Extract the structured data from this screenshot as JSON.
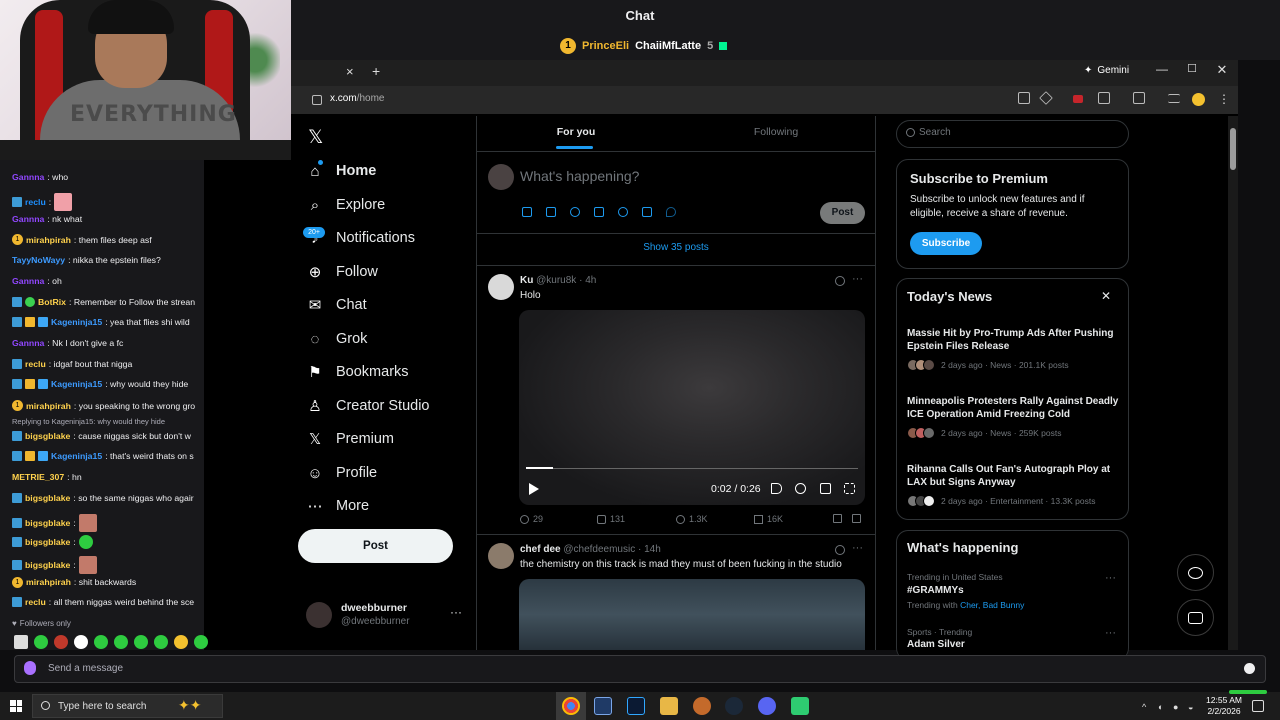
{
  "twitch": {
    "chat_title": "Chat",
    "leaderboard": {
      "rank": "1",
      "first_name": "PrinceEli",
      "second_name": "ChaiiMfLatte",
      "second_count": "5"
    },
    "messages": [
      {
        "user": "Gannna",
        "color": "#9147ff",
        "text": ": who",
        "badges": [],
        "emote": null
      },
      {
        "user": "reclu",
        "color": "#1e90ff",
        "text": ":",
        "badges": [
          "sub"
        ],
        "emote": "pink"
      },
      {
        "user": "Gannna",
        "color": "#9147ff",
        "text": ": nk what",
        "badges": [],
        "emote": null
      },
      {
        "user": "mirahpirah",
        "color": "#ffd24d",
        "text": ": them files deep asf",
        "badges": [
          "gold"
        ],
        "emote": null
      },
      {
        "user": "TayyNoWayy",
        "color": "#3d9bff",
        "text": ": nikka the epstein files?",
        "badges": [],
        "emote": null
      },
      {
        "user": "Gannna",
        "color": "#9147ff",
        "text": ": oh",
        "badges": [],
        "emote": null
      },
      {
        "user": "BotRix",
        "color": "#ffd24d",
        "text": ": Remember to Follow the strean",
        "badges": [
          "sub",
          "bot"
        ],
        "emote": null
      },
      {
        "user": "Kageninja15",
        "color": "#3d9bff",
        "text": ": yea that flies shi wild",
        "badges": [
          "sub",
          "crown",
          "gift"
        ],
        "emote": null
      },
      {
        "user": "Gannna",
        "color": "#9147ff",
        "text": ": Nk I don't give a fc",
        "badges": [],
        "emote": null
      },
      {
        "user": "reclu",
        "color": "#ffd24d",
        "text": ": idgaf bout that nigga",
        "badges": [
          "sub"
        ],
        "emote": null
      },
      {
        "user": "Kageninja15",
        "color": "#3d9bff",
        "text": ": why would they hide",
        "badges": [
          "sub",
          "crown",
          "gift"
        ],
        "emote": null
      },
      {
        "user": "mirahpirah",
        "color": "#ffd24d",
        "text": ": you speaking to the wrong gro",
        "badges": [
          "gold"
        ],
        "emote": null
      },
      {
        "user": "bigsgblake",
        "color": "#ffd24d",
        "text": ": cause niggas sick but don't w",
        "badges": [
          "sub"
        ],
        "emote": null,
        "reply": "Replying to Kageninja15: why would they hide"
      },
      {
        "user": "Kageninja15",
        "color": "#3d9bff",
        "text": ": that's weird thats on s",
        "badges": [
          "sub",
          "crown",
          "gift"
        ],
        "emote": null
      },
      {
        "user": "METRIE_307",
        "color": "#ffd24d",
        "text": ": hn",
        "badges": [],
        "emote": null
      },
      {
        "user": "bigsgblake",
        "color": "#ffd24d",
        "text": ": so the same niggas who agair",
        "badges": [
          "sub"
        ],
        "emote": null
      },
      {
        "user": "bigsgblake",
        "color": "#ffd24d",
        "text": ":",
        "badges": [
          "sub"
        ],
        "emote": "face"
      },
      {
        "user": "bigsgblake",
        "color": "#ffd24d",
        "text": ":",
        "badges": [
          "sub"
        ],
        "emote": "green"
      },
      {
        "user": "bigsgblake",
        "color": "#ffd24d",
        "text": ":",
        "badges": [
          "sub"
        ],
        "emote": "face"
      },
      {
        "user": "mirahpirah",
        "color": "#ffd24d",
        "text": ": shit backwards",
        "badges": [
          "gold"
        ],
        "emote": null
      },
      {
        "user": "reclu",
        "color": "#ffd24d",
        "text": ": all them niggas weird behind the sce",
        "badges": [
          "sub"
        ],
        "emote": null
      }
    ],
    "followers_only": "Followers only",
    "send_placeholder": "Send a message"
  },
  "browser": {
    "tab_close": "×",
    "tab_new": "+",
    "gemini": "Gemini",
    "url_domain": "x.com",
    "url_path": "/home",
    "min": "—",
    "max": "☐",
    "close": "✕"
  },
  "x": {
    "logo": "𝕏",
    "nav": [
      {
        "label": "Home",
        "icon": "⌂",
        "active": true
      },
      {
        "label": "Explore",
        "icon": "⌕"
      },
      {
        "label": "Notifications",
        "icon": "♪"
      },
      {
        "label": "Follow",
        "icon": "⊕"
      },
      {
        "label": "Chat",
        "icon": "✉"
      },
      {
        "label": "Grok",
        "icon": "◌"
      },
      {
        "label": "Bookmarks",
        "icon": "⚑"
      },
      {
        "label": "Creator Studio",
        "icon": "♙"
      },
      {
        "label": "Premium",
        "icon": "𝕏"
      },
      {
        "label": "Profile",
        "icon": "☺"
      },
      {
        "label": "More",
        "icon": "⋯"
      }
    ],
    "notif_badge": "20+",
    "post_button": "Post",
    "me": {
      "name": "dweebburner",
      "handle": "@dweebburner",
      "more": "···"
    },
    "tabs": {
      "for_you": "For you",
      "following": "Following"
    },
    "compose_placeholder": "What's happening?",
    "compose_post": "Post",
    "show_posts": "Show 35 posts",
    "tweets": [
      {
        "name": "Ku",
        "handle": "@kuru8k",
        "time": "4h",
        "text": "Holo",
        "video_time": "0:02 / 0:26",
        "video_progress": 0.08,
        "replies": "29",
        "reposts": "131",
        "likes": "1.3K",
        "views": "16K"
      },
      {
        "name": "chef dee",
        "handle": "@chefdeemusic",
        "time": "14h",
        "text": "the chemistry on this track is mad they must of been fucking in the studio"
      }
    ],
    "search_placeholder": "Search",
    "premium": {
      "title": "Subscribe to Premium",
      "body": "Subscribe to unlock new features and if eligible, receive a share of revenue.",
      "button": "Subscribe"
    },
    "news": {
      "title": "Today's News",
      "items": [
        {
          "headline": "Massie Hit by Pro-Trump Ads After Pushing Epstein Files Release",
          "meta": "2 days ago · News · 201.1K posts"
        },
        {
          "headline": "Minneapolis Protesters Rally Against Deadly ICE Operation Amid Freezing Cold",
          "meta": "2 days ago · News · 259K posts"
        },
        {
          "headline": "Rihanna Calls Out Fan's Autograph Ploy at LAX but Signs Anyway",
          "meta": "2 days ago · Entertainment · 13.3K posts"
        }
      ]
    },
    "happening": {
      "title": "What's happening",
      "trends": [
        {
          "meta": "Trending in United States",
          "name": "#GRAMMYs",
          "with_label": "Trending with",
          "with": "Cher, Bad Bunny"
        },
        {
          "meta": "Sports · Trending",
          "name": "Adam Silver"
        }
      ]
    }
  },
  "taskbar": {
    "search_placeholder": "Type here to search",
    "time": "12:55 AM",
    "date": "2/2/2026",
    "tray_caret": "^"
  }
}
